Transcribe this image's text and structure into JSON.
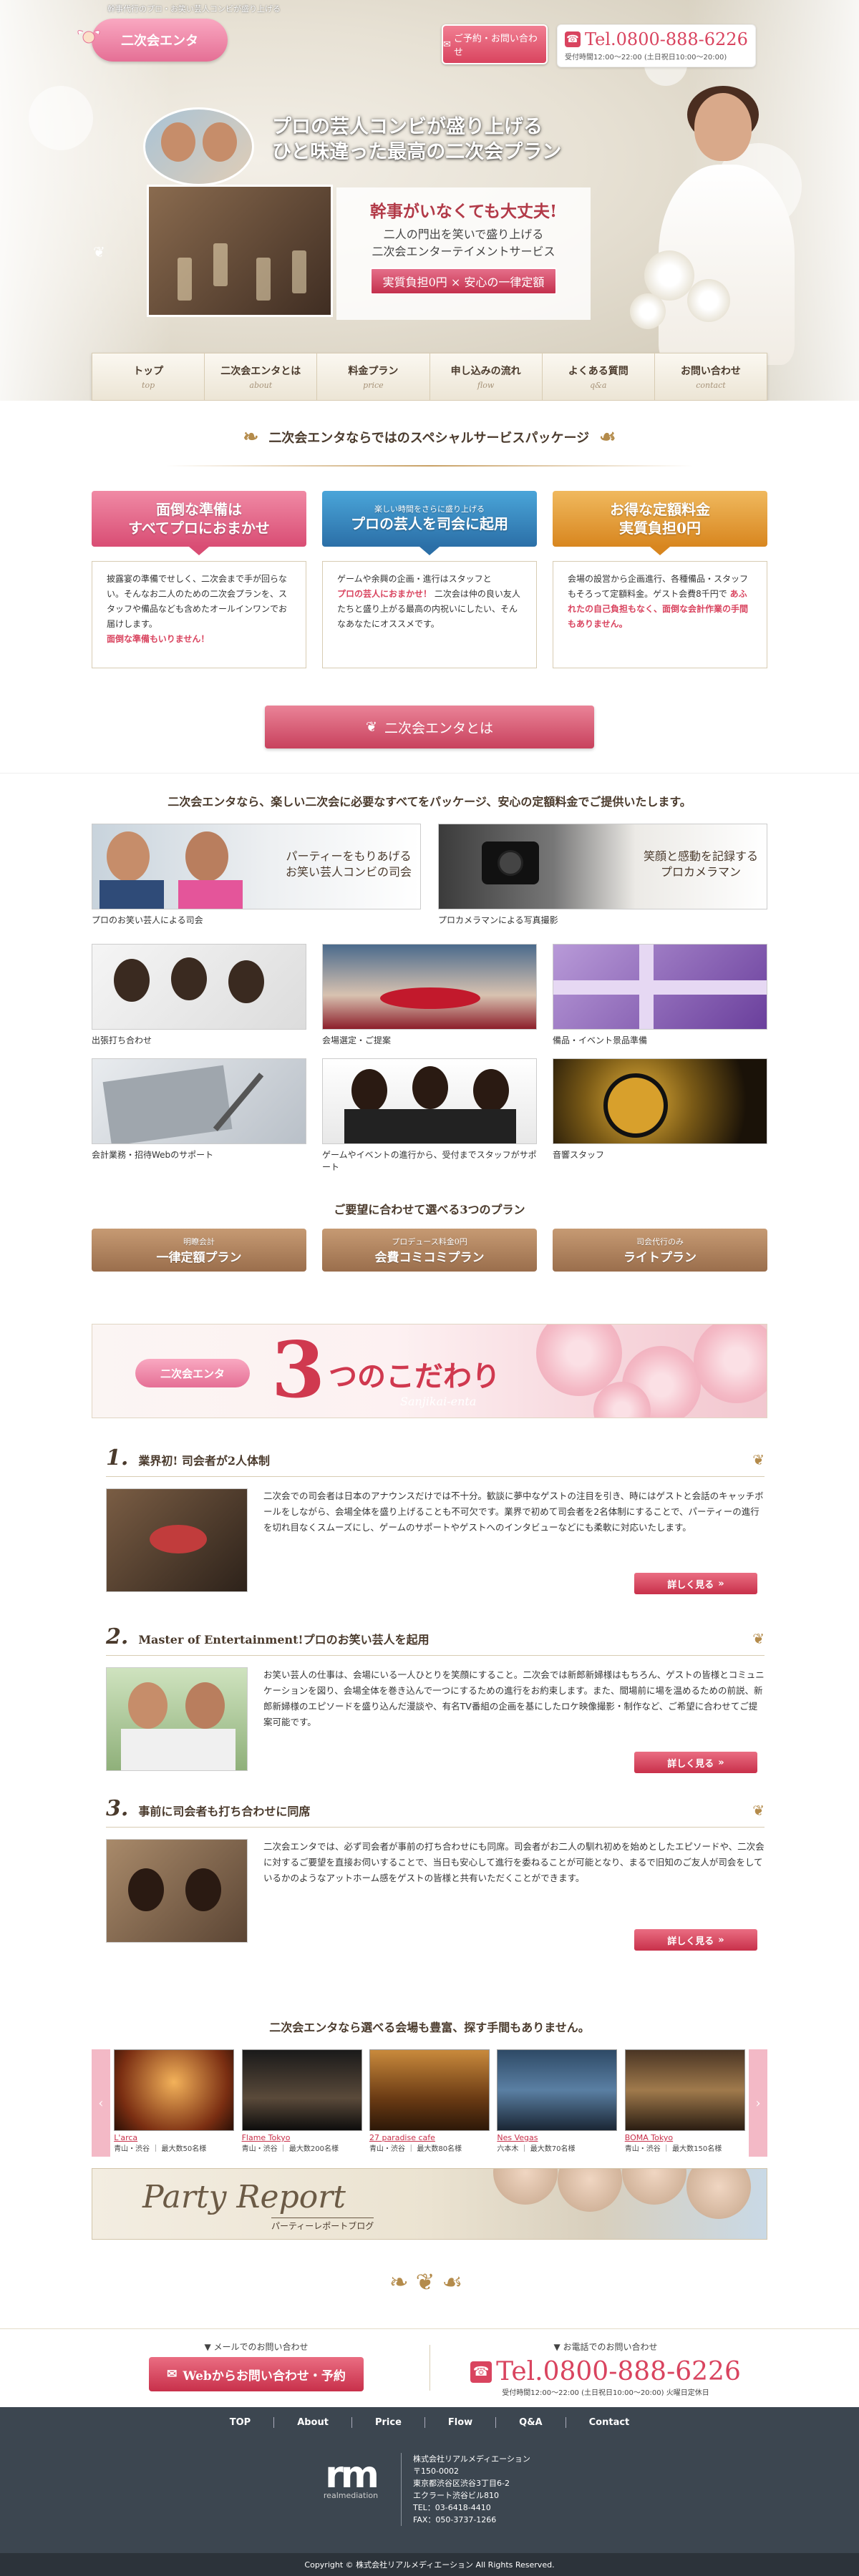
{
  "header": {
    "tagline": "幹事代行のプロ・お笑い芸人コンビが盛り上げる",
    "logo_text": "二次会エンタ",
    "contact_button": "ご予約・お問い合わせ",
    "tel": "Tel.0800-888-6226",
    "hours": "受付時間12:00～22:00 (土日祝日10:00～20:00)"
  },
  "hero": {
    "catch_line1": "プロの芸人コンビが盛り上げる",
    "catch_line2": "ひと味違った最高の二次会プラン",
    "panel_title": "幹事がいなくても大丈夫!",
    "panel_line1": "二人の門出を笑いで盛り上げる",
    "panel_line2": "二次会エンターテイメントサービス",
    "panel_badge": "実質負担0円 × 安心の一律定額"
  },
  "nav": [
    {
      "jp": "トップ",
      "en": "top"
    },
    {
      "jp": "二次会エンタとは",
      "en": "about"
    },
    {
      "jp": "料金プラン",
      "en": "price"
    },
    {
      "jp": "申し込みの流れ",
      "en": "flow"
    },
    {
      "jp": "よくある質問",
      "en": "q&a"
    },
    {
      "jp": "お問い合わせ",
      "en": "contact"
    }
  ],
  "special": {
    "title": "二次会エンタならではのスペシャルサービスパッケージ",
    "packages": [
      {
        "small": "",
        "line1": "面倒な準備は",
        "line2": "すべてプロにおまかせ",
        "color": "#d94d74",
        "body": "披露宴の準備でせしく、二次会まで手が回らない。そんなお二人のための二次会プランを、スタッフや備品なども含めたオールインワンでお届けします。",
        "highlight": "面倒な準備もいりません！"
      },
      {
        "small": "楽しい時間をさらに盛り上げる",
        "line1": "プロの芸人を司会に起用",
        "line2": "",
        "color": "#2b6fa7",
        "body_pre": "ゲームや余興の企画・進行はスタッフと",
        "highlight": "プロの芸人におまかせ！",
        "body": "二次会は仲の良い友人たちと盛り上がる最高の内祝いにしたい、そんなあなたにオススメです。"
      },
      {
        "small": "",
        "line1": "お得な定額料金",
        "line2": "実質負担0円",
        "color": "#d8861f",
        "body": "会場の設営から企画進行、各種備品・スタッフもそろって定額料金。ゲスト会費8千円で",
        "highlight": "あふれたの自己負担もなく、面倒な会計作業の手間もありません。"
      }
    ],
    "cta": "二次会エンタとは"
  },
  "services": {
    "lead": "二次会エンタなら、楽しい二次会に必要なすべてをパッケージ、安心の定額料金でご提供いたします。",
    "big": [
      {
        "overlay1": "パーティーをもりあげる",
        "overlay2": "お笑い芸人コンビの司会",
        "caption": "プロのお笑い芸人による司会"
      },
      {
        "overlay1": "笑顔と感動を記録する",
        "overlay2": "プロカメラマン",
        "caption": "プロカメラマンによる写真撮影"
      }
    ],
    "small": [
      {
        "caption": "出張打ち合わせ"
      },
      {
        "caption": "会場選定・ご提案"
      },
      {
        "caption": "備品・イベント景品準備"
      },
      {
        "caption": "会計業務・招待Webのサポート"
      },
      {
        "caption": "ゲームやイベントの進行から、受付までスタッフがサポート"
      },
      {
        "caption": "音響スタッフ"
      }
    ],
    "plans_title": "ご要望に合わせて選べる3つのプラン",
    "plans": [
      {
        "small": "明瞭会計",
        "name": "一律定額プラン"
      },
      {
        "small": "プロデュース料金0円",
        "name": "会費コミコミプラン"
      },
      {
        "small": "司会代行のみ",
        "name": "ライトプラン"
      }
    ]
  },
  "kodawari": {
    "logo_text": "二次会エンタ",
    "three": "3",
    "title": "つのこだわり",
    "script": "Sanjikai-enta",
    "more_label": "詳しく見る",
    "points": [
      {
        "num": "1.",
        "title": "業界初! 司会者が2人体制",
        "text": "二次会での司会者は日本のアナウンスだけでは不十分。歓談に夢中なゲストの注目を引き、時にはゲストと会話のキャッチボールをしながら、会場全体を盛り上げることも不可欠です。業界で初めて司会者を2名体制にすることで、パーティーの進行を切れ目なくスムーズにし、ゲームのサポートやゲストへのインタビューなどにも柔軟に対応いたします。"
      },
      {
        "num": "2.",
        "title": "Master of Entertainment!プロのお笑い芸人を起用",
        "text": "お笑い芸人の仕事は、会場にいる一人ひとりを笑顔にすること。二次会では新郎新婦様はもちろん、ゲストの皆様とコミュニケーションを図り、会場全体を巻き込んで一つにするための進行をお約束します。また、間場前に場を温めるための前説、新郎新婦様のエピソードを盛り込んだ漫談や、有名TV番組の企画を基にしたロケ映像撮影・制作など、ご希望に合わせてご提案可能です。"
      },
      {
        "num": "3.",
        "title": "事前に司会者も打ち合わせに同席",
        "text": "二次会エンタでは、必ず司会者が事前の打ち合わせにも同席。司会者がお二人の馴れ初めを始めとしたエピソードや、二次会に対するご要望を直接お伺いすることで、当日も安心して進行を委ねることが可能となり、まるで旧知のご友人が司会をしているかのようなアットホーム感をゲストの皆様と共有いただくことができます。"
      }
    ]
  },
  "venues": {
    "lead": "二次会エンタなら選べる会場も豊富、探す手間もありません。",
    "prev": "‹",
    "next": "›",
    "items": [
      {
        "name": "L'arca",
        "info": "青山・渋谷 ｜ 最大数50名様"
      },
      {
        "name": "Flame Tokyo",
        "info": "青山・渋谷 ｜ 最大数200名様"
      },
      {
        "name": "27 paradise cafe",
        "info": "青山・渋谷 ｜ 最大数80名様"
      },
      {
        "name": "Nes Vegas",
        "info": "六本木 ｜ 最大数70名様"
      },
      {
        "name": "BOMA Tokyo",
        "info": "青山・渋谷 ｜ 最大数150名様"
      }
    ]
  },
  "report": {
    "title": "Party Report",
    "subtitle": "パーティーレポートブログ"
  },
  "contact_strip": {
    "web_label": "メールでのお問い合わせ",
    "web_button": "Webからお問い合わせ・予約",
    "tel_label": "お電話でのお問い合わせ",
    "tel": "Tel.0800-888-6226",
    "hours": "受付時間12:00～22:00 (土日祝日10:00～20:00) 火曜日定休日"
  },
  "footer": {
    "nav": [
      "TOP",
      "About",
      "Price",
      "Flow",
      "Q&A",
      "Contact"
    ],
    "logo_mark": "rm",
    "logo_word": "realmediation",
    "company": "株式会社リアルメディエーション",
    "zip": "〒150-0002",
    "addr1": "東京都渋谷区渋谷3丁目6-2",
    "addr2": "エクラート渋谷ビル810",
    "tel": "TEL：03-6418-4410",
    "fax": "FAX：050-3737-1266",
    "copyright": "Copyright © 株式会社リアルメディエーション All Rights Reserved."
  },
  "colors": {
    "accent_pink": "#d9445f",
    "nav_bg": "#ece5d5",
    "footer_bg": "#3c4650",
    "ornament_gold": "#b48b4b"
  }
}
